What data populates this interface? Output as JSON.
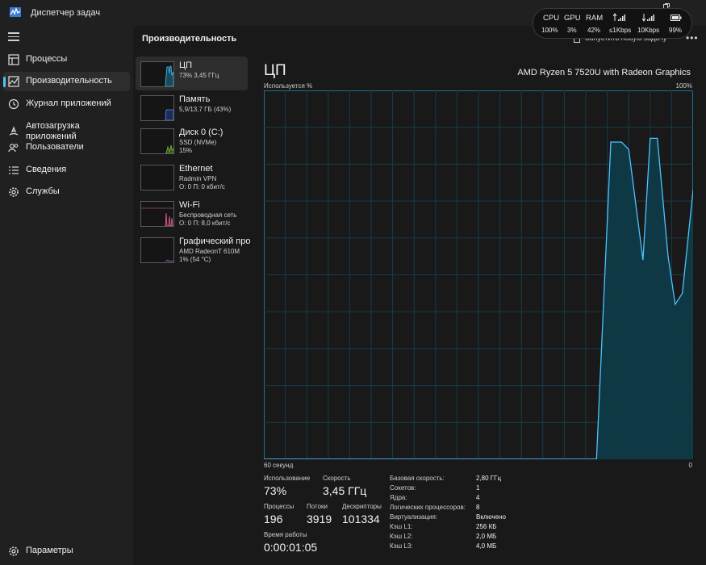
{
  "app": {
    "title": "Диспетчер задач",
    "page_title": "Производительность",
    "run_task": "Запустить новую задачу",
    "more": "•••"
  },
  "sidebar": {
    "items": [
      {
        "label": "Процессы",
        "icon": "processes-icon"
      },
      {
        "label": "Производительность",
        "icon": "performance-icon",
        "active": true
      },
      {
        "label": "Журнал приложений",
        "icon": "history-icon"
      },
      {
        "label": "Автозагрузка приложений",
        "icon": "startup-icon"
      },
      {
        "label": "Пользователи",
        "icon": "users-icon"
      },
      {
        "label": "Сведения",
        "icon": "details-icon"
      },
      {
        "label": "Службы",
        "icon": "services-icon"
      }
    ],
    "settings": "Параметры"
  },
  "resources": [
    {
      "name": "ЦП",
      "l2": "73% 3,45 ГГц",
      "l3": "",
      "color": "#4cc2ff",
      "active": true
    },
    {
      "name": "Память",
      "l2": "5,9/13,7 ГБ (43%)",
      "l3": "",
      "color": "#5b8cff"
    },
    {
      "name": "Диск 0 (C:)",
      "l2": "SSD (NVMe)",
      "l3": "15%",
      "color": "#79c24a"
    },
    {
      "name": "Ethernet",
      "l2": "Radmin VPN",
      "l3": "О: 0 П: 0 кбит/с",
      "color": "#c0c0c0"
    },
    {
      "name": "Wi-Fi",
      "l2": "Беспроводная сеть",
      "l3": "О: 0 П: 8,0 кбит/с",
      "color": "#e8609a"
    },
    {
      "name": "Графический про",
      "l2": "AMD RadeonT 610M",
      "l3": "1% (54 °C)",
      "color": "#c060e0"
    }
  ],
  "cpu": {
    "title": "ЦП",
    "model": "AMD Ryzen 5 7520U with Radeon Graphics",
    "usage_label": "Используется %",
    "max_label": "100%",
    "time_left": "60 секунд",
    "time_right": "0",
    "stats": {
      "usage_label": "Использование",
      "usage": "73%",
      "speed_label": "Скорость",
      "speed": "3,45 ГГц",
      "processes_label": "Процессы",
      "processes": "196",
      "threads_label": "Потоки",
      "threads": "3919",
      "handles_label": "Дескрипторы",
      "handles": "101334",
      "uptime_label": "Время работы",
      "uptime": "0:00:01:05"
    },
    "specs": [
      {
        "label": "Базовая скорость:",
        "value": "2,80 ГГц"
      },
      {
        "label": "Сокетов:",
        "value": "1"
      },
      {
        "label": "Ядра:",
        "value": "4"
      },
      {
        "label": "Логических процессоров:",
        "value": "8"
      },
      {
        "label": "Виртуализация:",
        "value": "Включено"
      },
      {
        "label": "Кэш L1:",
        "value": "256 КБ"
      },
      {
        "label": "Кэш L2:",
        "value": "2,0 МБ"
      },
      {
        "label": "Кэш L3:",
        "value": "4,0 МБ"
      }
    ]
  },
  "overlay": {
    "cpu_label": "CPU",
    "cpu": "100%",
    "gpu_label": "GPU",
    "gpu": "3%",
    "ram_label": "RAM",
    "ram": "42%",
    "up": "≤1Kbps",
    "down": "10Kbps",
    "battery": "99%"
  },
  "chart_data": {
    "type": "area",
    "x": [
      60,
      59,
      58,
      57,
      56,
      55,
      54,
      53,
      52,
      51,
      50,
      49,
      48,
      47,
      46,
      45,
      44,
      43,
      42,
      41,
      40,
      39,
      38,
      37,
      36,
      35,
      34,
      33,
      32,
      31,
      30,
      29,
      28,
      27,
      26,
      25,
      24,
      23,
      22,
      21,
      20,
      19,
      18,
      17,
      16,
      15,
      14,
      13,
      12,
      11,
      10,
      9,
      8,
      7,
      6,
      5,
      4,
      3,
      2,
      1,
      0
    ],
    "values": [
      0,
      0,
      0,
      0,
      0,
      0,
      0,
      0,
      0,
      0,
      0,
      0,
      0,
      0,
      0,
      0,
      0,
      0,
      0,
      0,
      0,
      0,
      0,
      0,
      0,
      0,
      0,
      0,
      0,
      0,
      0,
      0,
      0,
      0,
      0,
      0,
      0,
      0,
      0,
      0,
      0,
      0,
      0,
      0,
      0,
      0,
      0,
      0,
      0,
      0,
      0,
      0,
      0,
      0,
      0,
      0,
      43,
      86,
      85,
      55,
      87,
      55,
      43,
      45,
      73
    ],
    "xlabel": "60 секунд",
    "ylabel": "Используется %",
    "ylim": [
      0,
      100
    ],
    "xlim": [
      60,
      0
    ],
    "points": [
      [
        60,
        0
      ],
      [
        13.5,
        0
      ],
      [
        12.5,
        43
      ],
      [
        11.5,
        86
      ],
      [
        10,
        86
      ],
      [
        9,
        84
      ],
      [
        7,
        54
      ],
      [
        6,
        87
      ],
      [
        5,
        87
      ],
      [
        3.5,
        55
      ],
      [
        2.5,
        42
      ],
      [
        1.5,
        45
      ],
      [
        0,
        73
      ]
    ],
    "color": "#4cc2ff",
    "grid": true
  }
}
